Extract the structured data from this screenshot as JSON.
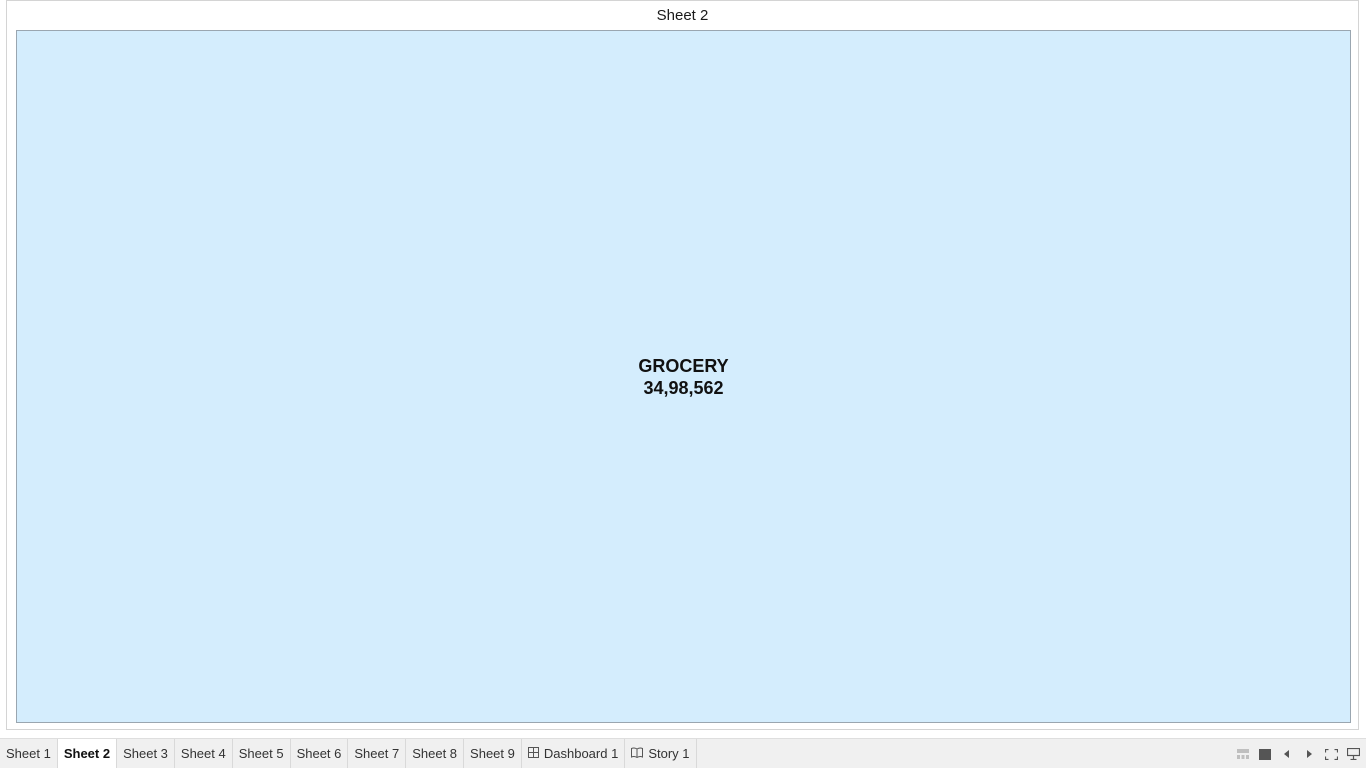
{
  "sheet": {
    "title": "Sheet 2"
  },
  "colors": {
    "tile_fill": "#d4edfd",
    "tile_border": "#9aa6b0"
  },
  "chart_data": {
    "type": "treemap",
    "items": [
      {
        "category": "GROCERY",
        "value": 3498562,
        "value_label": "34,98,562"
      }
    ]
  },
  "tabs": [
    {
      "label": "Sheet 1",
      "kind": "sheet",
      "active": false
    },
    {
      "label": "Sheet 2",
      "kind": "sheet",
      "active": true
    },
    {
      "label": "Sheet 3",
      "kind": "sheet",
      "active": false
    },
    {
      "label": "Sheet 4",
      "kind": "sheet",
      "active": false
    },
    {
      "label": "Sheet 5",
      "kind": "sheet",
      "active": false
    },
    {
      "label": "Sheet 6",
      "kind": "sheet",
      "active": false
    },
    {
      "label": "Sheet 7",
      "kind": "sheet",
      "active": false
    },
    {
      "label": "Sheet 8",
      "kind": "sheet",
      "active": false
    },
    {
      "label": "Sheet 9",
      "kind": "sheet",
      "active": false
    },
    {
      "label": "Dashboard 1",
      "kind": "dashboard",
      "active": false,
      "icon": "dashboard-grid-icon"
    },
    {
      "label": "Story 1",
      "kind": "story",
      "active": false,
      "icon": "story-book-icon"
    }
  ],
  "controls": [
    {
      "icon": "filmstrip-view-icon"
    },
    {
      "icon": "single-view-icon"
    },
    {
      "icon": "previous-sheet-icon"
    },
    {
      "icon": "next-sheet-icon"
    },
    {
      "icon": "fullscreen-icon"
    },
    {
      "icon": "presentation-mode-icon"
    }
  ]
}
